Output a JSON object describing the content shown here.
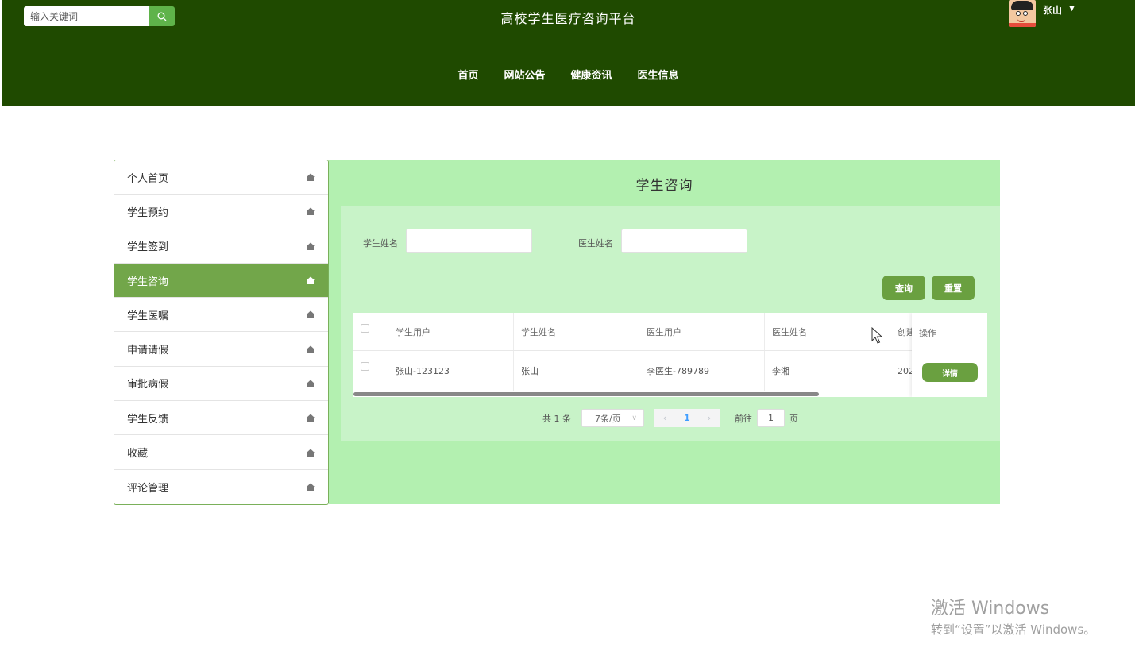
{
  "header": {
    "site_title": "高校学生医疗咨询平台",
    "search_placeholder": "输入关键词",
    "user_name": "张山",
    "nav": [
      "首页",
      "网站公告",
      "健康资讯",
      "医生信息"
    ]
  },
  "sidebar": {
    "items": [
      {
        "label": "个人首页"
      },
      {
        "label": "学生预约"
      },
      {
        "label": "学生签到"
      },
      {
        "label": "学生咨询",
        "active": true
      },
      {
        "label": "学生医嘱"
      },
      {
        "label": "申请请假"
      },
      {
        "label": "审批病假"
      },
      {
        "label": "学生反馈"
      },
      {
        "label": "收藏"
      },
      {
        "label": "评论管理"
      }
    ]
  },
  "main": {
    "title": "学生咨询",
    "filters": {
      "student_name_label": "学生姓名",
      "doctor_name_label": "医生姓名"
    },
    "buttons": {
      "query": "查询",
      "reset": "重置"
    },
    "table": {
      "columns": [
        "学生用户",
        "学生姓名",
        "医生用户",
        "医生姓名",
        "创建"
      ],
      "op_column": "操作",
      "rows": [
        {
          "student_user": "张山-123123",
          "student_name": "张山",
          "doctor_user": "李医生-789789",
          "doctor_name": "李湘",
          "created": "202",
          "detail": "详情"
        }
      ]
    },
    "pagination": {
      "total": "共 1 条",
      "page_size": "7条/页",
      "current_page": "1",
      "goto_label": "前往",
      "goto_value": "1",
      "page_suffix": "页"
    }
  },
  "watermark": {
    "title": "激活 Windows",
    "subtitle": "转到“设置”以激活 Windows。"
  },
  "colors": {
    "header_bg": "#1f4a00",
    "accent": "#6aa040",
    "main_bg": "#b3f0b0",
    "panel_bg": "#c8f3c8"
  }
}
